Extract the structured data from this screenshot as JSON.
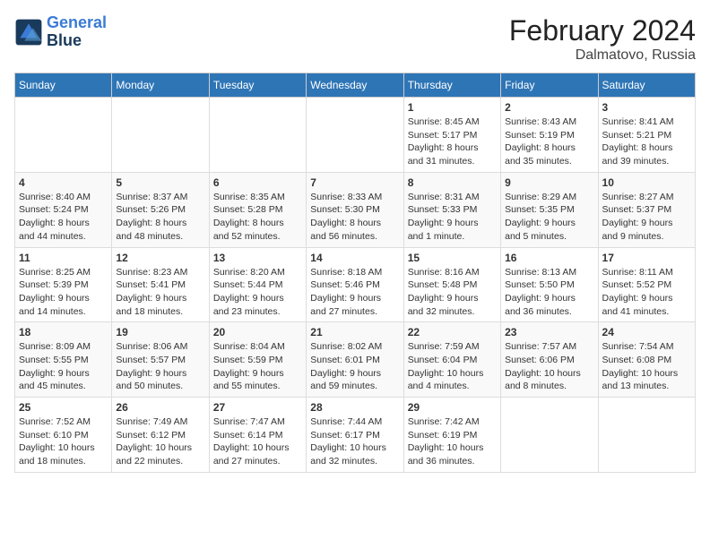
{
  "header": {
    "logo_line1": "General",
    "logo_line2": "Blue",
    "month_title": "February 2024",
    "location": "Dalmatovo, Russia"
  },
  "days_of_week": [
    "Sunday",
    "Monday",
    "Tuesday",
    "Wednesday",
    "Thursday",
    "Friday",
    "Saturday"
  ],
  "weeks": [
    [
      {
        "day": "",
        "info": ""
      },
      {
        "day": "",
        "info": ""
      },
      {
        "day": "",
        "info": ""
      },
      {
        "day": "",
        "info": ""
      },
      {
        "day": "1",
        "info": "Sunrise: 8:45 AM\nSunset: 5:17 PM\nDaylight: 8 hours\nand 31 minutes."
      },
      {
        "day": "2",
        "info": "Sunrise: 8:43 AM\nSunset: 5:19 PM\nDaylight: 8 hours\nand 35 minutes."
      },
      {
        "day": "3",
        "info": "Sunrise: 8:41 AM\nSunset: 5:21 PM\nDaylight: 8 hours\nand 39 minutes."
      }
    ],
    [
      {
        "day": "4",
        "info": "Sunrise: 8:40 AM\nSunset: 5:24 PM\nDaylight: 8 hours\nand 44 minutes."
      },
      {
        "day": "5",
        "info": "Sunrise: 8:37 AM\nSunset: 5:26 PM\nDaylight: 8 hours\nand 48 minutes."
      },
      {
        "day": "6",
        "info": "Sunrise: 8:35 AM\nSunset: 5:28 PM\nDaylight: 8 hours\nand 52 minutes."
      },
      {
        "day": "7",
        "info": "Sunrise: 8:33 AM\nSunset: 5:30 PM\nDaylight: 8 hours\nand 56 minutes."
      },
      {
        "day": "8",
        "info": "Sunrise: 8:31 AM\nSunset: 5:33 PM\nDaylight: 9 hours\nand 1 minute."
      },
      {
        "day": "9",
        "info": "Sunrise: 8:29 AM\nSunset: 5:35 PM\nDaylight: 9 hours\nand 5 minutes."
      },
      {
        "day": "10",
        "info": "Sunrise: 8:27 AM\nSunset: 5:37 PM\nDaylight: 9 hours\nand 9 minutes."
      }
    ],
    [
      {
        "day": "11",
        "info": "Sunrise: 8:25 AM\nSunset: 5:39 PM\nDaylight: 9 hours\nand 14 minutes."
      },
      {
        "day": "12",
        "info": "Sunrise: 8:23 AM\nSunset: 5:41 PM\nDaylight: 9 hours\nand 18 minutes."
      },
      {
        "day": "13",
        "info": "Sunrise: 8:20 AM\nSunset: 5:44 PM\nDaylight: 9 hours\nand 23 minutes."
      },
      {
        "day": "14",
        "info": "Sunrise: 8:18 AM\nSunset: 5:46 PM\nDaylight: 9 hours\nand 27 minutes."
      },
      {
        "day": "15",
        "info": "Sunrise: 8:16 AM\nSunset: 5:48 PM\nDaylight: 9 hours\nand 32 minutes."
      },
      {
        "day": "16",
        "info": "Sunrise: 8:13 AM\nSunset: 5:50 PM\nDaylight: 9 hours\nand 36 minutes."
      },
      {
        "day": "17",
        "info": "Sunrise: 8:11 AM\nSunset: 5:52 PM\nDaylight: 9 hours\nand 41 minutes."
      }
    ],
    [
      {
        "day": "18",
        "info": "Sunrise: 8:09 AM\nSunset: 5:55 PM\nDaylight: 9 hours\nand 45 minutes."
      },
      {
        "day": "19",
        "info": "Sunrise: 8:06 AM\nSunset: 5:57 PM\nDaylight: 9 hours\nand 50 minutes."
      },
      {
        "day": "20",
        "info": "Sunrise: 8:04 AM\nSunset: 5:59 PM\nDaylight: 9 hours\nand 55 minutes."
      },
      {
        "day": "21",
        "info": "Sunrise: 8:02 AM\nSunset: 6:01 PM\nDaylight: 9 hours\nand 59 minutes."
      },
      {
        "day": "22",
        "info": "Sunrise: 7:59 AM\nSunset: 6:04 PM\nDaylight: 10 hours\nand 4 minutes."
      },
      {
        "day": "23",
        "info": "Sunrise: 7:57 AM\nSunset: 6:06 PM\nDaylight: 10 hours\nand 8 minutes."
      },
      {
        "day": "24",
        "info": "Sunrise: 7:54 AM\nSunset: 6:08 PM\nDaylight: 10 hours\nand 13 minutes."
      }
    ],
    [
      {
        "day": "25",
        "info": "Sunrise: 7:52 AM\nSunset: 6:10 PM\nDaylight: 10 hours\nand 18 minutes."
      },
      {
        "day": "26",
        "info": "Sunrise: 7:49 AM\nSunset: 6:12 PM\nDaylight: 10 hours\nand 22 minutes."
      },
      {
        "day": "27",
        "info": "Sunrise: 7:47 AM\nSunset: 6:14 PM\nDaylight: 10 hours\nand 27 minutes."
      },
      {
        "day": "28",
        "info": "Sunrise: 7:44 AM\nSunset: 6:17 PM\nDaylight: 10 hours\nand 32 minutes."
      },
      {
        "day": "29",
        "info": "Sunrise: 7:42 AM\nSunset: 6:19 PM\nDaylight: 10 hours\nand 36 minutes."
      },
      {
        "day": "",
        "info": ""
      },
      {
        "day": "",
        "info": ""
      }
    ]
  ]
}
